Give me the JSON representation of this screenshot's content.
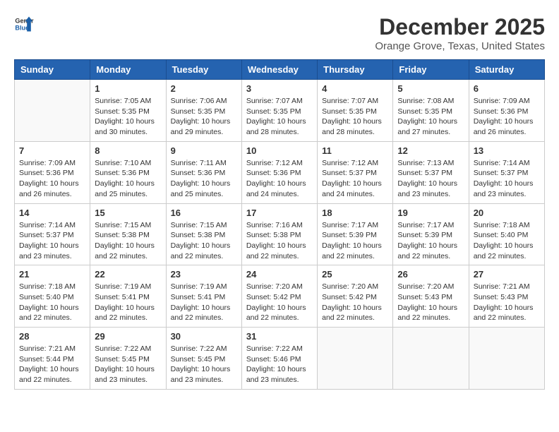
{
  "header": {
    "logo_line1": "General",
    "logo_line2": "Blue",
    "title": "December 2025",
    "subtitle": "Orange Grove, Texas, United States"
  },
  "calendar": {
    "days_of_week": [
      "Sunday",
      "Monday",
      "Tuesday",
      "Wednesday",
      "Thursday",
      "Friday",
      "Saturday"
    ],
    "weeks": [
      [
        {
          "day": "",
          "details": ""
        },
        {
          "day": "1",
          "details": "Sunrise: 7:05 AM\nSunset: 5:35 PM\nDaylight: 10 hours\nand 30 minutes."
        },
        {
          "day": "2",
          "details": "Sunrise: 7:06 AM\nSunset: 5:35 PM\nDaylight: 10 hours\nand 29 minutes."
        },
        {
          "day": "3",
          "details": "Sunrise: 7:07 AM\nSunset: 5:35 PM\nDaylight: 10 hours\nand 28 minutes."
        },
        {
          "day": "4",
          "details": "Sunrise: 7:07 AM\nSunset: 5:35 PM\nDaylight: 10 hours\nand 28 minutes."
        },
        {
          "day": "5",
          "details": "Sunrise: 7:08 AM\nSunset: 5:35 PM\nDaylight: 10 hours\nand 27 minutes."
        },
        {
          "day": "6",
          "details": "Sunrise: 7:09 AM\nSunset: 5:36 PM\nDaylight: 10 hours\nand 26 minutes."
        }
      ],
      [
        {
          "day": "7",
          "details": "Sunrise: 7:09 AM\nSunset: 5:36 PM\nDaylight: 10 hours\nand 26 minutes."
        },
        {
          "day": "8",
          "details": "Sunrise: 7:10 AM\nSunset: 5:36 PM\nDaylight: 10 hours\nand 25 minutes."
        },
        {
          "day": "9",
          "details": "Sunrise: 7:11 AM\nSunset: 5:36 PM\nDaylight: 10 hours\nand 25 minutes."
        },
        {
          "day": "10",
          "details": "Sunrise: 7:12 AM\nSunset: 5:36 PM\nDaylight: 10 hours\nand 24 minutes."
        },
        {
          "day": "11",
          "details": "Sunrise: 7:12 AM\nSunset: 5:37 PM\nDaylight: 10 hours\nand 24 minutes."
        },
        {
          "day": "12",
          "details": "Sunrise: 7:13 AM\nSunset: 5:37 PM\nDaylight: 10 hours\nand 23 minutes."
        },
        {
          "day": "13",
          "details": "Sunrise: 7:14 AM\nSunset: 5:37 PM\nDaylight: 10 hours\nand 23 minutes."
        }
      ],
      [
        {
          "day": "14",
          "details": "Sunrise: 7:14 AM\nSunset: 5:37 PM\nDaylight: 10 hours\nand 23 minutes."
        },
        {
          "day": "15",
          "details": "Sunrise: 7:15 AM\nSunset: 5:38 PM\nDaylight: 10 hours\nand 22 minutes."
        },
        {
          "day": "16",
          "details": "Sunrise: 7:15 AM\nSunset: 5:38 PM\nDaylight: 10 hours\nand 22 minutes."
        },
        {
          "day": "17",
          "details": "Sunrise: 7:16 AM\nSunset: 5:38 PM\nDaylight: 10 hours\nand 22 minutes."
        },
        {
          "day": "18",
          "details": "Sunrise: 7:17 AM\nSunset: 5:39 PM\nDaylight: 10 hours\nand 22 minutes."
        },
        {
          "day": "19",
          "details": "Sunrise: 7:17 AM\nSunset: 5:39 PM\nDaylight: 10 hours\nand 22 minutes."
        },
        {
          "day": "20",
          "details": "Sunrise: 7:18 AM\nSunset: 5:40 PM\nDaylight: 10 hours\nand 22 minutes."
        }
      ],
      [
        {
          "day": "21",
          "details": "Sunrise: 7:18 AM\nSunset: 5:40 PM\nDaylight: 10 hours\nand 22 minutes."
        },
        {
          "day": "22",
          "details": "Sunrise: 7:19 AM\nSunset: 5:41 PM\nDaylight: 10 hours\nand 22 minutes."
        },
        {
          "day": "23",
          "details": "Sunrise: 7:19 AM\nSunset: 5:41 PM\nDaylight: 10 hours\nand 22 minutes."
        },
        {
          "day": "24",
          "details": "Sunrise: 7:20 AM\nSunset: 5:42 PM\nDaylight: 10 hours\nand 22 minutes."
        },
        {
          "day": "25",
          "details": "Sunrise: 7:20 AM\nSunset: 5:42 PM\nDaylight: 10 hours\nand 22 minutes."
        },
        {
          "day": "26",
          "details": "Sunrise: 7:20 AM\nSunset: 5:43 PM\nDaylight: 10 hours\nand 22 minutes."
        },
        {
          "day": "27",
          "details": "Sunrise: 7:21 AM\nSunset: 5:43 PM\nDaylight: 10 hours\nand 22 minutes."
        }
      ],
      [
        {
          "day": "28",
          "details": "Sunrise: 7:21 AM\nSunset: 5:44 PM\nDaylight: 10 hours\nand 22 minutes."
        },
        {
          "day": "29",
          "details": "Sunrise: 7:22 AM\nSunset: 5:45 PM\nDaylight: 10 hours\nand 23 minutes."
        },
        {
          "day": "30",
          "details": "Sunrise: 7:22 AM\nSunset: 5:45 PM\nDaylight: 10 hours\nand 23 minutes."
        },
        {
          "day": "31",
          "details": "Sunrise: 7:22 AM\nSunset: 5:46 PM\nDaylight: 10 hours\nand 23 minutes."
        },
        {
          "day": "",
          "details": ""
        },
        {
          "day": "",
          "details": ""
        },
        {
          "day": "",
          "details": ""
        }
      ]
    ]
  }
}
